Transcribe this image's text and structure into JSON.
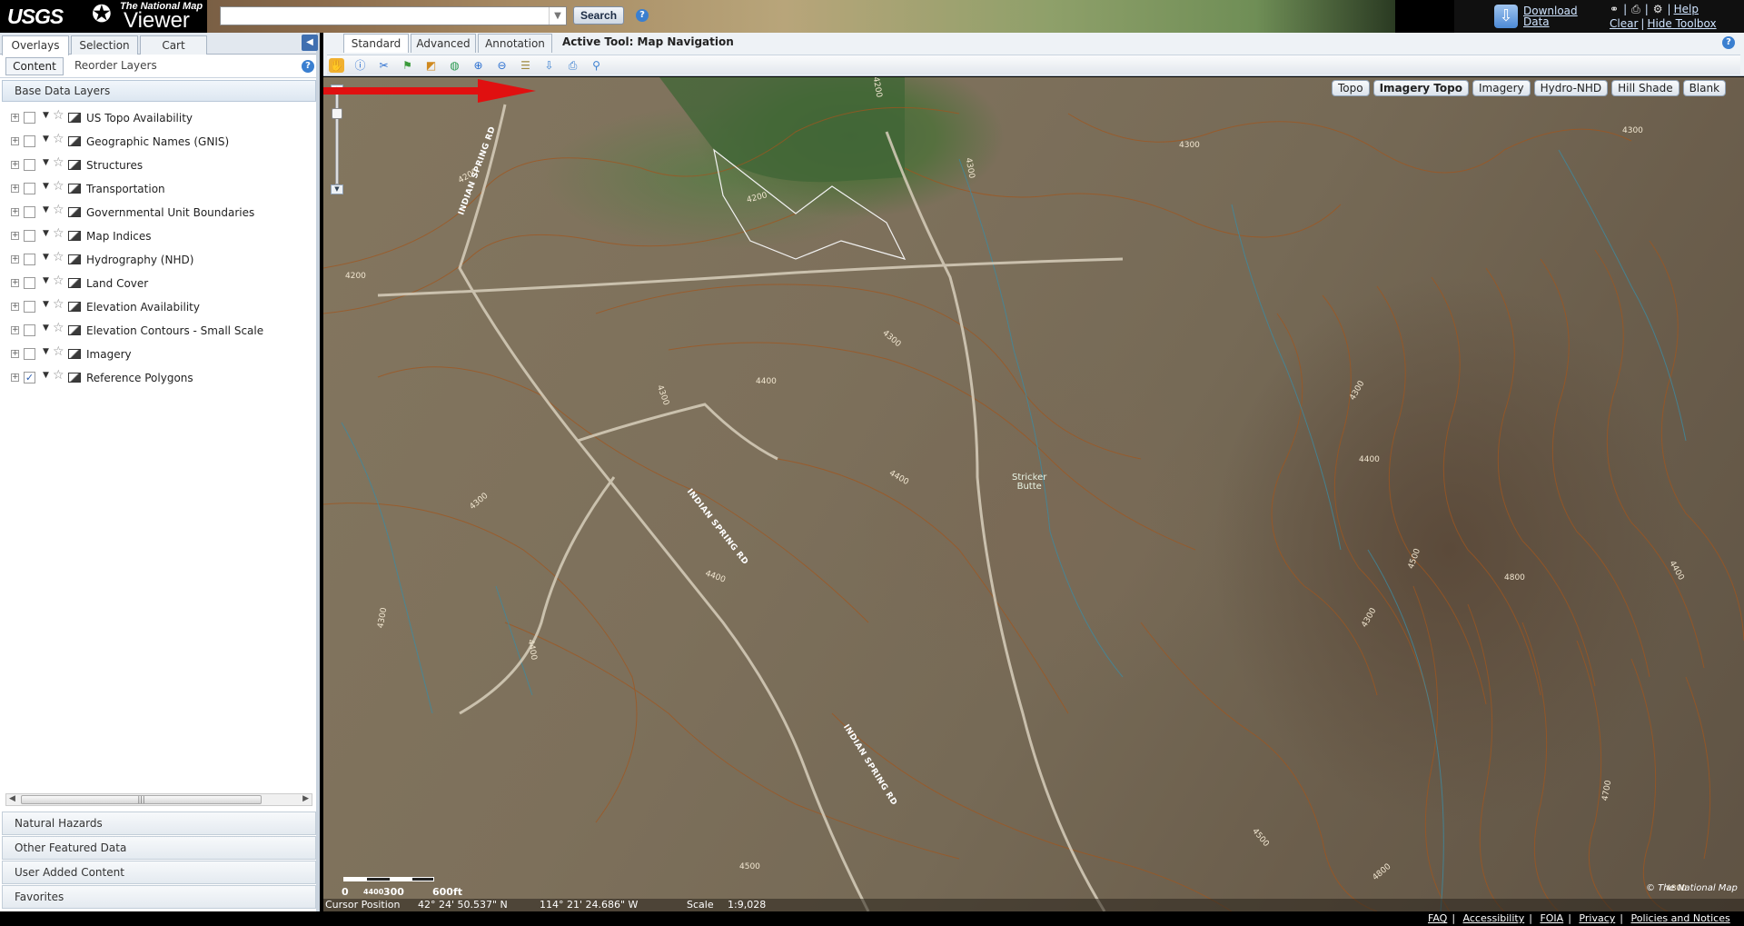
{
  "header": {
    "logo": {
      "agency": "USGS",
      "tagline": "The National Map",
      "product": "Viewer"
    },
    "search": {
      "value": "",
      "placeholder": "",
      "button_label": "Search",
      "help": "?"
    },
    "download": {
      "line1": "Download",
      "line2": "Data"
    },
    "links": {
      "help": "Help",
      "clear": "Clear",
      "hide_toolbox": "Hide Toolbox"
    }
  },
  "left_panel": {
    "tabs": [
      {
        "label": "Overlays"
      },
      {
        "label": "Selection"
      },
      {
        "label": "Cart"
      }
    ],
    "subtabs": {
      "content": "Content",
      "reorder": "Reorder Layers"
    },
    "section_title": "Base Data Layers",
    "layers": [
      {
        "label": "US Topo Availability",
        "checked": false
      },
      {
        "label": "Geographic Names (GNIS)",
        "checked": false
      },
      {
        "label": "Structures",
        "checked": false
      },
      {
        "label": "Transportation",
        "checked": false
      },
      {
        "label": "Governmental Unit Boundaries",
        "checked": false
      },
      {
        "label": "Map Indices",
        "checked": false
      },
      {
        "label": "Hydrography (NHD)",
        "checked": false
      },
      {
        "label": "Land Cover",
        "checked": false
      },
      {
        "label": "Elevation Availability",
        "checked": false
      },
      {
        "label": "Elevation Contours - Small Scale",
        "checked": false
      },
      {
        "label": "Imagery",
        "checked": false
      },
      {
        "label": "Reference Polygons",
        "checked": true
      }
    ],
    "accordion": [
      {
        "label": "Natural Hazards"
      },
      {
        "label": "Other Featured Data"
      },
      {
        "label": "User Added Content"
      },
      {
        "label": "Favorites"
      }
    ]
  },
  "toolbar": {
    "tabs": [
      {
        "label": "Standard"
      },
      {
        "label": "Advanced"
      },
      {
        "label": "Annotation"
      }
    ],
    "active_tool": "Active Tool: Map Navigation",
    "help": "?",
    "tools": [
      "pan-tool-icon",
      "identify-icon",
      "measure-icon",
      "flag-icon",
      "extent-icon",
      "globe-icon",
      "zoom-in-icon",
      "zoom-out-icon",
      "layer-list-icon",
      "download-icon",
      "print-icon",
      "pin-icon"
    ]
  },
  "map": {
    "basemaps": [
      {
        "label": "Topo",
        "selected": false
      },
      {
        "label": "Imagery Topo",
        "selected": true
      },
      {
        "label": "Imagery",
        "selected": false
      },
      {
        "label": "Hydro-NHD",
        "selected": false
      },
      {
        "label": "Hill Shade",
        "selected": false
      },
      {
        "label": "Blank",
        "selected": false
      }
    ],
    "contour_labels": [
      "4200",
      "4200",
      "4200",
      "4200",
      "4300",
      "4300",
      "4300",
      "4300",
      "4300",
      "4300",
      "4300",
      "4300",
      "4400",
      "4400",
      "4400",
      "4400",
      "4400",
      "4500",
      "4500",
      "4500",
      "4700",
      "4800",
      "4800",
      "4800",
      "4300",
      "4400"
    ],
    "road_labels": [
      "INDIAN SPRING RD",
      "INDIAN SPRING RD",
      "INDIAN SPRING RD"
    ],
    "place_label": {
      "line1": "Stricker",
      "line2": "Butte"
    },
    "scale": {
      "zero": "0",
      "mid_m": "4400",
      "mid": "300",
      "end": "600ft"
    },
    "credit": "© The National Map"
  },
  "status": {
    "cursor_label": "Cursor Position",
    "lat": "42° 24' 50.537\" N",
    "lon": "114° 21' 24.686\" W",
    "scale_label": "Scale",
    "scale_value": "1:9,028"
  },
  "footer": {
    "links": [
      {
        "label": "FAQ"
      },
      {
        "label": "Accessibility"
      },
      {
        "label": "FOIA"
      },
      {
        "label": "Privacy"
      },
      {
        "label": "Policies and Notices"
      }
    ]
  },
  "colors": {
    "accent": "#3f6fb0",
    "arrow": "#e01010",
    "contour": "#a0561f",
    "stream": "#3d8aa0"
  }
}
